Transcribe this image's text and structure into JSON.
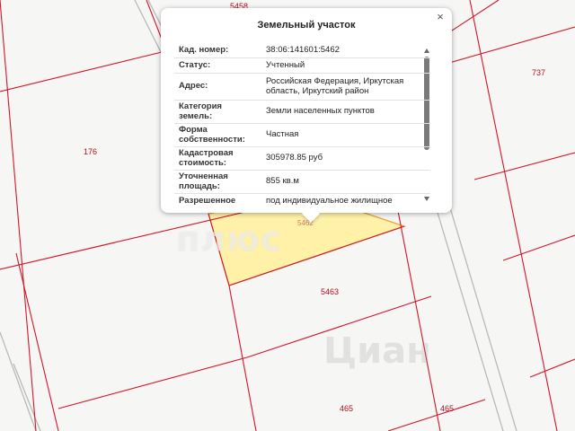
{
  "popup": {
    "title": "Земельный участок",
    "close_symbol": "×",
    "rows": [
      {
        "key": "Кад. номер:",
        "value": "38:06:141601:5462"
      },
      {
        "key": "Статус:",
        "value": "Учтенный"
      },
      {
        "key": "Адрес:",
        "value": "Российская Федерация, Иркутская область, Иркутский район"
      },
      {
        "key": "Категория земель:",
        "value": "Земли населенных пунктов"
      },
      {
        "key": "Форма собственности:",
        "value": "Частная"
      },
      {
        "key": "Кадастровая стоимость:",
        "value": "305978.85 руб"
      },
      {
        "key": "Уточненная площадь:",
        "value": "855 кв.м"
      },
      {
        "key": "Разрешенное",
        "value": "под индивидуальное жилищное"
      }
    ]
  },
  "map": {
    "parcel_labels": [
      "5458",
      "737",
      "176",
      "5462",
      "5463",
      "465",
      "465"
    ],
    "selected_fill": "#fff2a8",
    "boundary_color": "#d4142a",
    "road_color": "#b9b9b9"
  },
  "watermarks": [
    "плюс",
    "Циан"
  ]
}
